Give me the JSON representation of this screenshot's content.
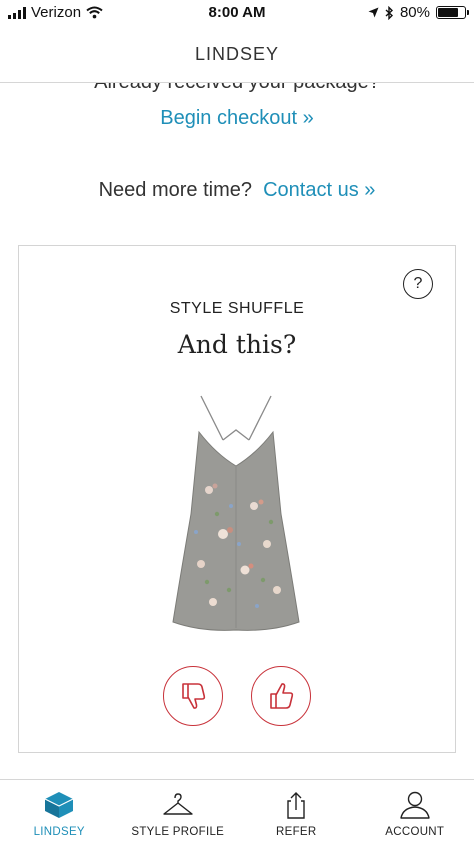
{
  "status_bar": {
    "carrier": "Verizon",
    "time": "8:00 AM",
    "battery_text": "80%",
    "battery_level": 0.8
  },
  "header": {
    "title": "LINDSEY"
  },
  "content": {
    "received_text": "Already received your package?",
    "checkout_link": "Begin checkout »",
    "more_time_text": "Need more time?",
    "contact_link": "Contact us »"
  },
  "style_shuffle": {
    "label": "STYLE SHUFFLE",
    "prompt": "And this?",
    "help_symbol": "?",
    "item_image": "floral-slip-dress",
    "dislike_icon": "thumbs-down-icon",
    "like_icon": "thumbs-up-icon",
    "vote_color": "#c8323a"
  },
  "tab_bar": {
    "tabs": [
      {
        "label": "LINDSEY",
        "icon": "box-icon",
        "active": true
      },
      {
        "label": "STYLE PROFILE",
        "icon": "hanger-icon",
        "active": false
      },
      {
        "label": "REFER",
        "icon": "share-icon",
        "active": false
      },
      {
        "label": "ACCOUNT",
        "icon": "person-icon",
        "active": false
      }
    ],
    "accent_color": "#1f8fb8"
  }
}
